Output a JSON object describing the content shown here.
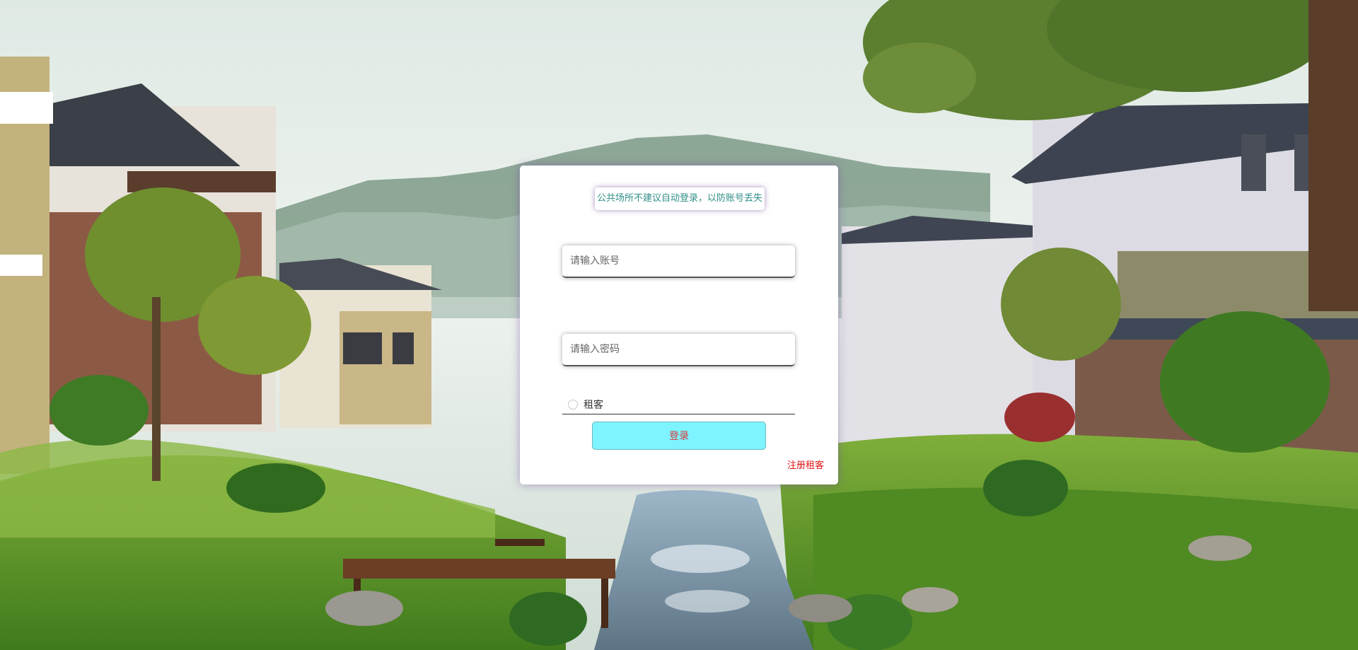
{
  "notice": {
    "text": "公共场所不建议自动登录，以防账号丢失"
  },
  "form": {
    "account_placeholder": "请输入账号",
    "password_placeholder": "请输入密码",
    "role_label": "租客",
    "login_label": "登录",
    "register_label": "注册租客"
  },
  "theme": {
    "login_button_color": "#7df4ff",
    "login_text_color": "#d83a3a",
    "register_link_color": "#e01414",
    "notice_text_color": "#2f8f87"
  }
}
